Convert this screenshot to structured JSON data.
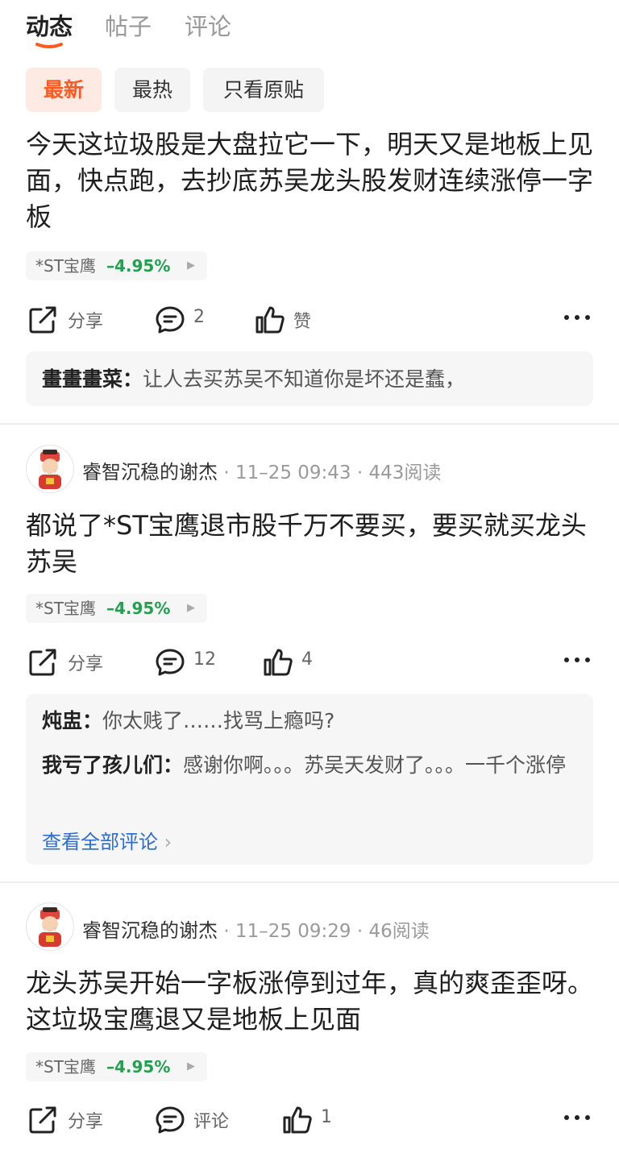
{
  "tabs": {
    "dynamic": "动态",
    "posts": "帖子",
    "comments": "评论"
  },
  "accent": "#ff5a1f",
  "filters": {
    "latest": "最新",
    "hot": "最热",
    "original_only": "只看原贴"
  },
  "posts": [
    {
      "text": "今天这垃圾股是大盘拉它一下，明天又是地板上见面，快点跑，去抄底苏吴龙头股发财连续涨停一字板",
      "stock": {
        "name": "*ST宝鹰",
        "change": "–4.95%"
      },
      "share": "分享",
      "comment_count": "2",
      "like_label": "赞",
      "replies": [
        {
          "author": "畫畫畫菜",
          "sep": "：",
          "text": "让人去买苏吴不知道你是坏还是蠢，"
        }
      ]
    },
    {
      "user": "睿智沉稳的谢杰",
      "dot": "·",
      "time": "11–25 09:43",
      "reads": "443阅读",
      "text": "都说了*ST宝鹰退市股千万不要买，要买就买龙头苏吴",
      "stock": {
        "name": "*ST宝鹰",
        "change": "–4.95%"
      },
      "share": "分享",
      "comment_count": "12",
      "like_count": "4",
      "replies": [
        {
          "author": "炖盅",
          "sep": "：",
          "text": "你太贱了……找骂上瘾吗?"
        },
        {
          "author": "我亏了孩儿们",
          "sep": "：",
          "text": "感谢你啊。。。苏吴天发财了。。。一千个涨停"
        }
      ],
      "view_all": "查看全部评论"
    },
    {
      "user": "睿智沉稳的谢杰",
      "dot": "·",
      "time": "11–25 09:29",
      "reads": "46阅读",
      "text": "龙头苏吴开始一字板涨停到过年，真的爽歪歪呀。这垃圾宝鹰退又是地板上见面",
      "stock": {
        "name": "*ST宝鹰",
        "change": "–4.95%"
      },
      "share": "分享",
      "comment_label": "评论",
      "like_count": "1"
    }
  ]
}
